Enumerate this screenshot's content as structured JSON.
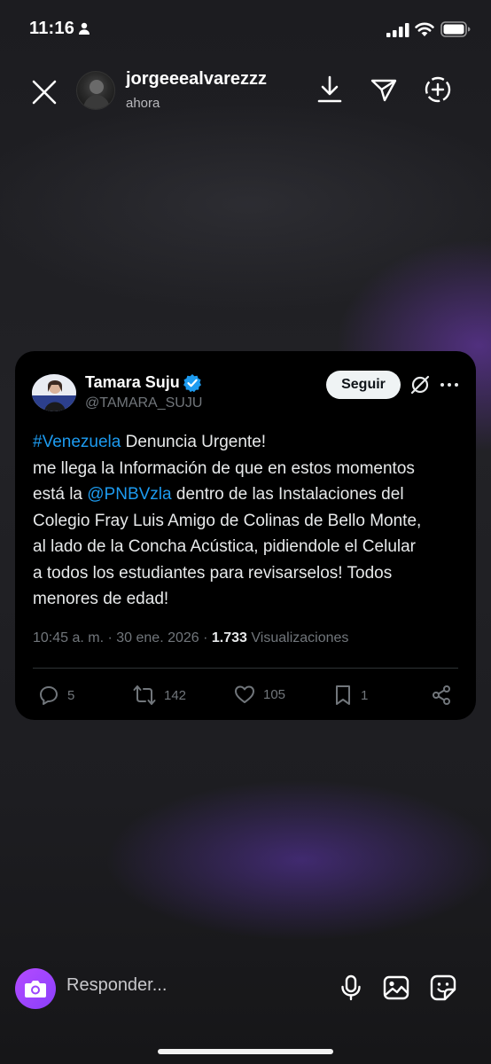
{
  "status_bar": {
    "time": "11:16"
  },
  "story": {
    "username": "jorgeeealvarezzz",
    "time_ago": "ahora"
  },
  "tweet": {
    "name": "Tamara Suju",
    "handle": "@TAMARA_SUJU",
    "follow_label": "Seguir",
    "body": {
      "hashtag": "#Venezuela",
      "line1_rest": " Denuncia  Urgente!",
      "line2": "me llega la Información de que en estos momentos",
      "line3_pre": "está la ",
      "mention": "@PNBVzla",
      "line3_rest": " dentro de las Instalaciones del",
      "line4": "Colegio Fray Luis Amigo de Colinas de Bello Monte,",
      "line5": "al lado de la Concha Acústica, pidiendole el Celular",
      "line6": "a todos los estudiantes para revisarselos!  Todos",
      "line7": "menores de edad!"
    },
    "meta": {
      "time_date": "10:45 a. m. · 30 ene. 2026 · ",
      "views_count": "1.733",
      "views_label": " Visualizaciones"
    },
    "actions": {
      "replies": "5",
      "retweets": "142",
      "likes": "105",
      "bookmarks": "1"
    },
    "colors": {
      "link": "#1d9bf0",
      "verified": "#1d9bf0"
    }
  },
  "reply_bar": {
    "placeholder": "Responder..."
  },
  "icons": [
    "person-icon",
    "signal-icon",
    "wifi-icon",
    "battery-icon",
    "close-icon",
    "download-icon",
    "send-icon",
    "add-icon",
    "verified-icon",
    "grok-icon",
    "more-icon",
    "reply-icon",
    "retweet-icon",
    "like-icon",
    "bookmark-icon",
    "share-icon",
    "camera-icon",
    "mic-icon",
    "gallery-icon",
    "sticker-icon"
  ]
}
